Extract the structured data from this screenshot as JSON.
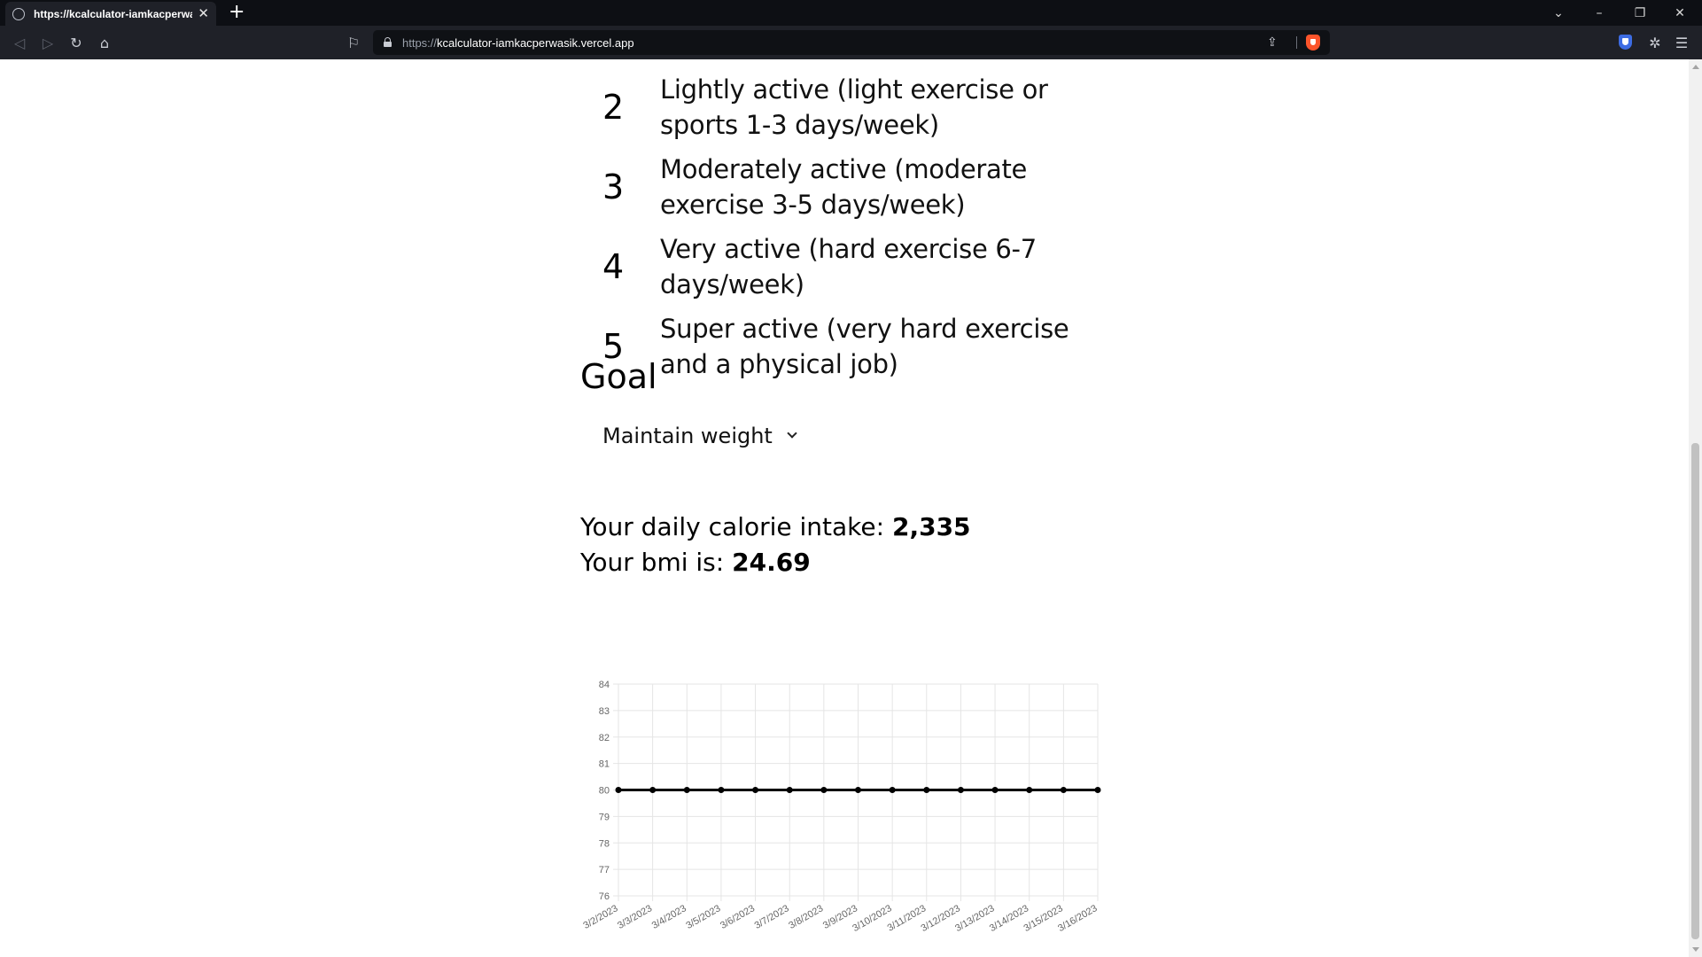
{
  "browser": {
    "tab_title": "https://kcalculator-iamkacperwasik.vercel.app",
    "url_scheme": "https://",
    "url_host": "kcalculator-iamkacperwasik.vercel.app"
  },
  "activity_levels": [
    {
      "number": "2",
      "description": "Lightly active (light exercise or sports 1-3 days/week)"
    },
    {
      "number": "3",
      "description": "Moderately active (moderate exercise 3-5 days/week)"
    },
    {
      "number": "4",
      "description": "Very active (hard exercise 6-7 days/week)"
    },
    {
      "number": "5",
      "description": "Super active (very hard exercise and a physical job)"
    }
  ],
  "goal": {
    "title": "Goal",
    "selected": "Maintain weight"
  },
  "results": {
    "calorie_label": "Your daily calorie intake: ",
    "calorie_value": "2,335",
    "bmi_label": "Your bmi is: ",
    "bmi_value": "24.69"
  },
  "chart_data": {
    "type": "line",
    "title": "",
    "xlabel": "",
    "ylabel": "",
    "categories": [
      "3/2/2023",
      "3/3/2023",
      "3/4/2023",
      "3/5/2023",
      "3/6/2023",
      "3/7/2023",
      "3/8/2023",
      "3/9/2023",
      "3/10/2023",
      "3/11/2023",
      "3/12/2023",
      "3/13/2023",
      "3/14/2023",
      "3/15/2023",
      "3/16/2023"
    ],
    "series": [
      {
        "values": [
          80,
          80,
          80,
          80,
          80,
          80,
          80,
          80,
          80,
          80,
          80,
          80,
          80,
          80,
          80
        ]
      }
    ],
    "yticks": [
      84,
      83,
      82,
      81,
      80,
      79,
      78,
      77,
      76
    ],
    "ylim": [
      76,
      84
    ],
    "grid": true,
    "line_color": "#000000",
    "grid_color": "#e5e5e5"
  }
}
